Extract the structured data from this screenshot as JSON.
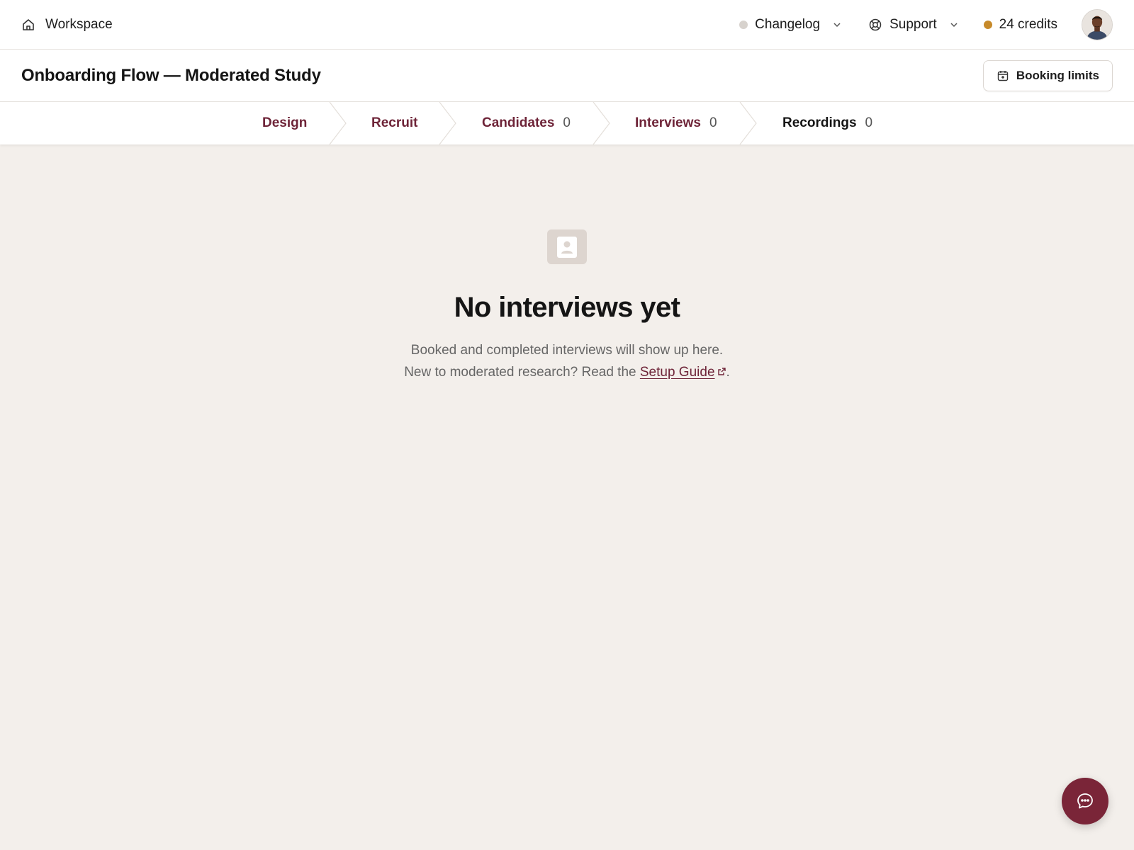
{
  "topbar": {
    "workspace_label": "Workspace",
    "changelog_label": "Changelog",
    "support_label": "Support",
    "credits_label": "24 credits",
    "changelog_dot_color": "#d7d2cd",
    "credits_dot_color": "#c78a2a"
  },
  "header": {
    "title": "Onboarding Flow — Moderated Study",
    "booking_limits_label": "Booking limits"
  },
  "steps": [
    {
      "label": "Design",
      "count": ""
    },
    {
      "label": "Recruit",
      "count": ""
    },
    {
      "label": "Candidates",
      "count": "0"
    },
    {
      "label": "Interviews",
      "count": "0"
    },
    {
      "label": "Recordings",
      "count": "0"
    }
  ],
  "empty_state": {
    "title": "No interviews yet",
    "line1": "Booked and completed interviews will show up here.",
    "line2_prefix": "New to moderated research? Read the ",
    "link_text": "Setup Guide",
    "line2_suffix": "."
  },
  "colors": {
    "accent": "#6e2438",
    "background": "#f3efeb",
    "fab": "#7a2538"
  },
  "icons": [
    "home-icon",
    "chevron-down-icon",
    "lifebuoy-icon",
    "calendar-icon",
    "contact-card-icon",
    "external-link-icon",
    "chat-bubble-icon"
  ]
}
